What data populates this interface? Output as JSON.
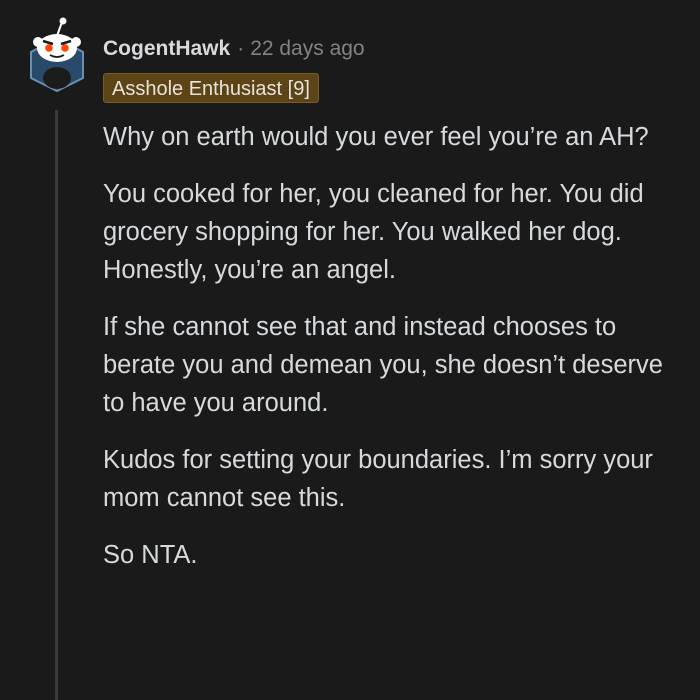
{
  "comment": {
    "username": "CogentHawk",
    "separator": "·",
    "timestamp": "22 days ago",
    "flair": "Asshole Enthusiast [9]",
    "flair_color": "#5c4417",
    "avatar_icon": "reddit-snoo-avatar-icon",
    "paragraphs": [
      "Why on earth would you ever feel you’re an AH?",
      "You cooked for her, you cleaned for her. You did grocery shopping for her. You walked her dog. Honestly, you’re an angel.",
      "If she cannot see that and instead chooses to berate you and demean you, she doesn’t deserve to have you around.",
      "Kudos for setting your boundaries. I’m sorry your mom cannot see this.",
      "So NTA."
    ]
  },
  "colors": {
    "background": "#1a1a1b",
    "text": "#d7dadc",
    "meta": "#818384",
    "thread_line": "#3a3a3c"
  }
}
